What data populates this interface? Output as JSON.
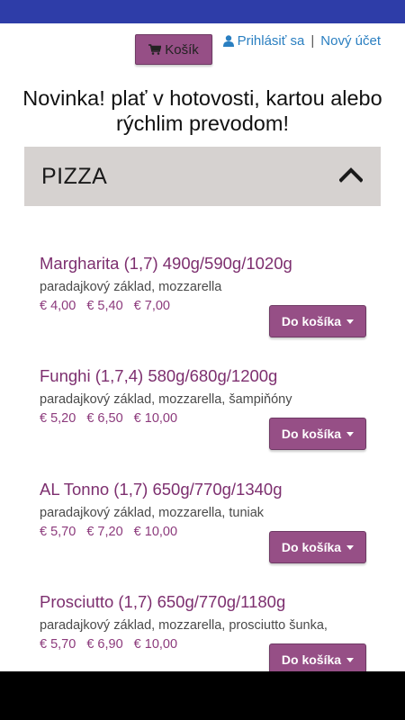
{
  "header": {
    "cart_label": "Košík",
    "login_label": "Prihlásiť sa",
    "separator": "|",
    "register_label": "Nový účet"
  },
  "promo_text": "Novinka! plať v hotovosti, kartou alebo rýchlim prevodom!",
  "category": {
    "title": "PIZZA",
    "expanded": true
  },
  "products": [
    {
      "name": "Margharita (1,7) 490g/590g/1020g",
      "description": "paradajkový základ, mozzarella",
      "prices": [
        "€ 4,00",
        "€ 5,40",
        "€ 7,00"
      ],
      "button_label": "Do košíka"
    },
    {
      "name": "Funghi (1,7,4) 580g/680g/1200g",
      "description": "paradajkový základ, mozzarella, šampiňóny",
      "prices": [
        "€ 5,20",
        "€ 6,50",
        "€ 10,00"
      ],
      "button_label": "Do košíka"
    },
    {
      "name": "AL Tonno (1,7) 650g/770g/1340g",
      "description": "paradajkový základ, mozzarella, tuniak",
      "prices": [
        "€ 5,70",
        "€ 7,20",
        "€ 10,00"
      ],
      "button_label": "Do košíka"
    },
    {
      "name": "Prosciutto (1,7) 650g/770g/1180g",
      "description": "paradajkový základ, mozzarella, prosciutto šunka,",
      "prices": [
        "€ 5,70",
        "€ 6,90",
        "€ 10,00"
      ],
      "button_label": "Do košíka"
    }
  ],
  "colors": {
    "status_bar": "#2e3da8",
    "accent": "#964f86",
    "product_name": "#7d2f6f",
    "link": "#2a7fc1",
    "category_bg": "#d6d2d0"
  }
}
